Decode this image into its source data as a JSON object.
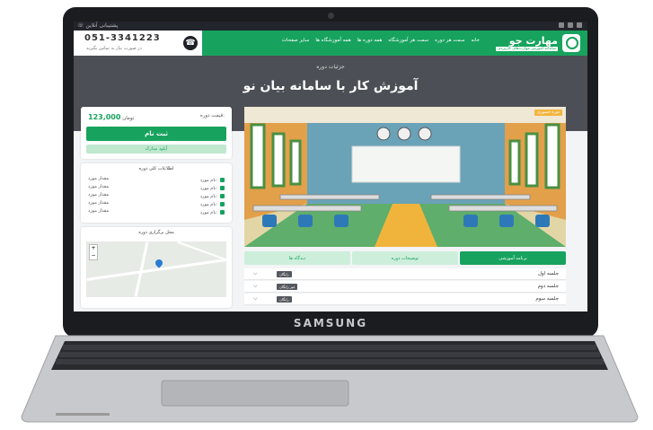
{
  "device": {
    "brand": "SAMSUNG"
  },
  "topbar": {
    "left_text": "☏ پشتیبانی آنلاین"
  },
  "header": {
    "phone": "051-3341223",
    "phone_sub": "در صورت نیاز به تماس بگیرید"
  },
  "logo": {
    "title": "مهارت جو",
    "subtitle": "سامانه آموزش مهارت‌های کاربردی"
  },
  "nav": {
    "items": [
      "خانه",
      "سمت هر دوره",
      "سمت هر آموزشگاه",
      "همه دوره ها",
      "همه آموزشگاه ها",
      "سایر صفحات"
    ]
  },
  "hero": {
    "breadcrumb": "جزئیات دوره",
    "title": "آموزش کار با سامانه بیان نو"
  },
  "price_card": {
    "label": "قیمت دوره:",
    "value": "123,000",
    "unit": "تومان",
    "register_label": "ثبت نام",
    "upload_label": "آپلود مدارک"
  },
  "info_card": {
    "title": "اطلاعات کلی دوره",
    "rows": [
      {
        "label": "نام مورد:",
        "value": "مقدار مورد"
      },
      {
        "label": "نام مورد:",
        "value": "مقدار مورد"
      },
      {
        "label": "نام مورد:",
        "value": "مقدار مورد"
      },
      {
        "label": "نام مورد:",
        "value": "مقدار مورد"
      },
      {
        "label": "نام مورد:",
        "value": "مقدار مورد"
      }
    ]
  },
  "map_card": {
    "title": "محل برگزاری دوره",
    "zoom_in": "+",
    "zoom_out": "−"
  },
  "course_image": {
    "tag": "دوره حضوری"
  },
  "tabs": [
    "برنامه آموزشی",
    "توضیحات دوره",
    "دیدگاه ها"
  ],
  "sessions": [
    {
      "title": "جلسه اول",
      "badge": "رایگان"
    },
    {
      "title": "جلسه دوم",
      "badge": "غیر رایگان"
    },
    {
      "title": "جلسه سوم",
      "badge": "رایگان"
    }
  ],
  "colors": {
    "accent": "#17a35e",
    "hero_bg": "#4c4f55"
  }
}
